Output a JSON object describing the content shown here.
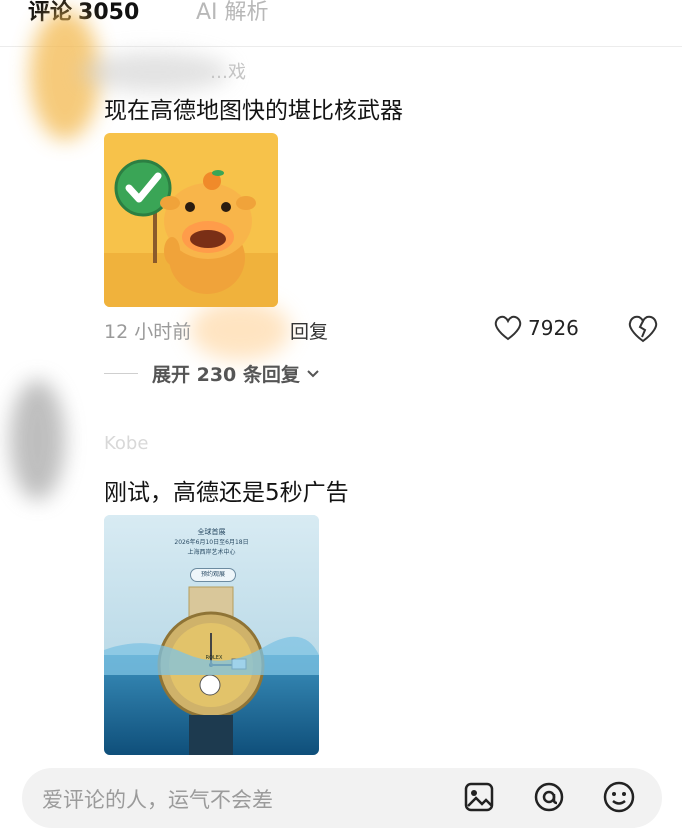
{
  "tabs": {
    "comments_label": "评论",
    "comments_count": "3050",
    "ai_label": "AI 解析"
  },
  "comments": [
    {
      "username": "…戏",
      "text": "现在高德地图快的堪比核武器",
      "time": "12 小时前",
      "reply_label": "回复",
      "like_count": "7926",
      "expand_label": "展开 230 条回复"
    },
    {
      "username": "Kobe",
      "text": "刚试，高德还是5秒广告",
      "ad": {
        "line1": "全球首展",
        "line2": "2026年6月10日至6月18日",
        "line3": "上海西岸艺术中心",
        "button": "预约观展",
        "brand": "ROLEX"
      }
    }
  ],
  "input": {
    "placeholder": "爱评论的人，运气不会差"
  },
  "colors": {
    "accent_green": "#3aa556",
    "mascot_bg": "#f7c24a",
    "ad_sky": "#cfe4ef",
    "ad_sea": "#1f6f9c"
  },
  "icons": [
    "heart-icon",
    "broken-heart-icon",
    "chevron-down-icon",
    "image-icon",
    "at-icon",
    "emoji-icon",
    "check-icon"
  ]
}
